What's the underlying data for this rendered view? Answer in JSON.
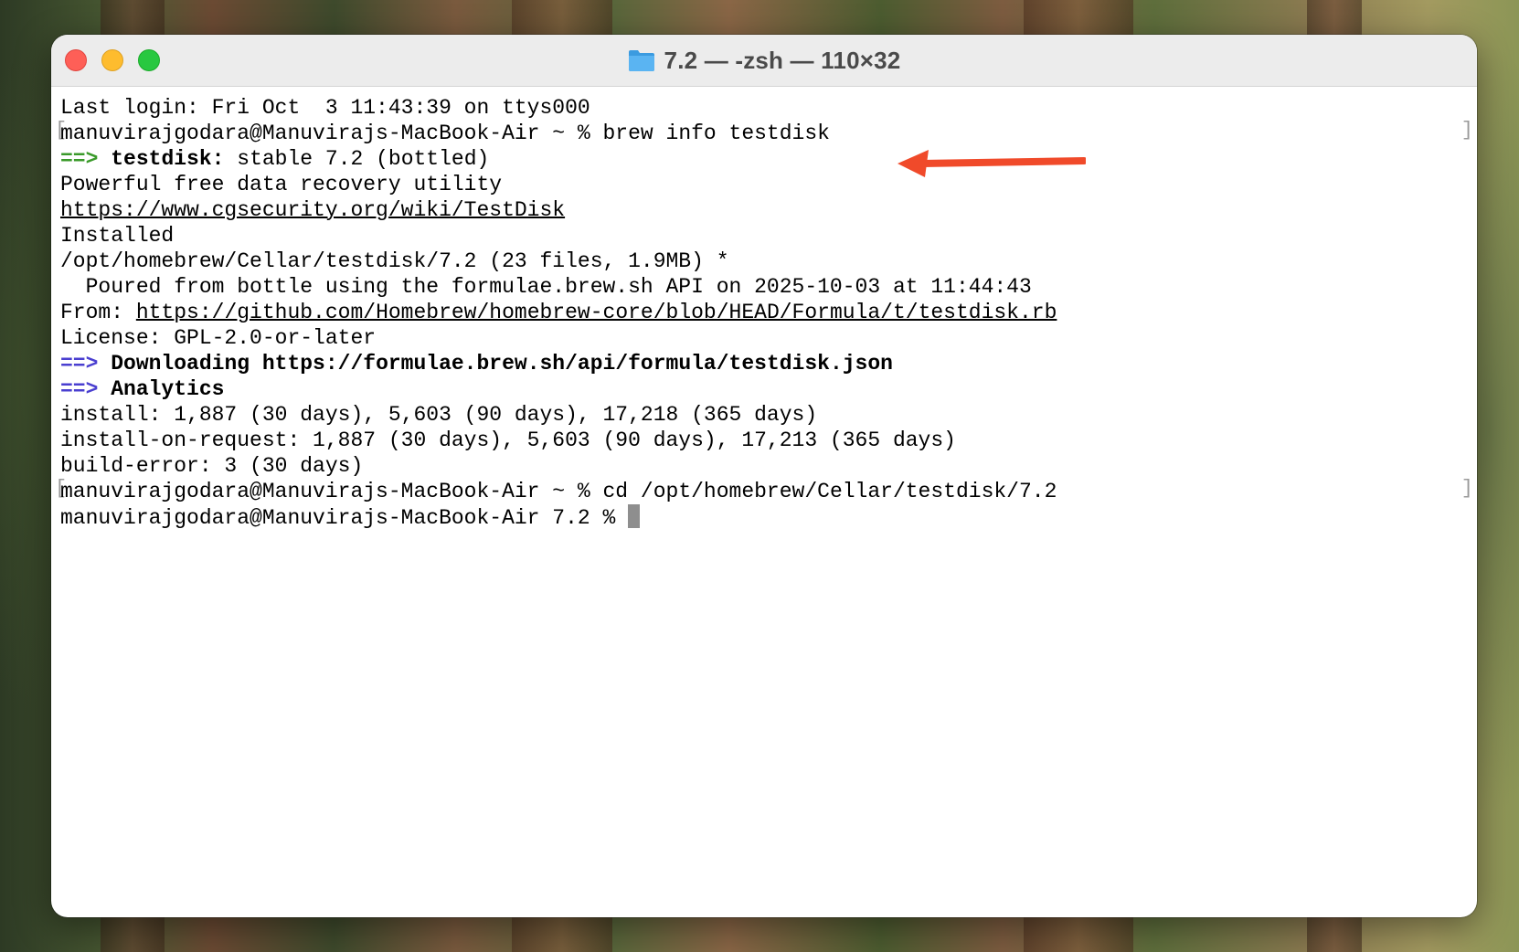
{
  "window": {
    "title": "7.2 — -zsh — 110×32",
    "folder_icon": "folder-icon",
    "traffic_lights": [
      "close",
      "minimize",
      "maximize"
    ]
  },
  "terminal": {
    "last_login": "Last login: Fri Oct  3 11:43:39 on ttys000",
    "prompt1": "manuvirajgodara@Manuvirajs-MacBook-Air ~ % ",
    "cmd1": "brew info testdisk",
    "arrow1": "==>",
    "formula_name": "testdisk:",
    "formula_version": " stable 7.2 (bottled)",
    "description": "Powerful free data recovery utility",
    "homepage": "https://www.cgsecurity.org/wiki/TestDisk",
    "installed_label": "Installed",
    "install_path": "/opt/homebrew/Cellar/testdisk/7.2 (23 files, 1.9MB) *",
    "poured_from": "  Poured from bottle using the formulae.brew.sh API on 2025-10-03 at 11:44:43",
    "from_label": "From: ",
    "from_url": "https://github.com/Homebrew/homebrew-core/blob/HEAD/Formula/t/testdisk.rb",
    "license": "License: GPL-2.0-or-later",
    "arrow2": "==>",
    "downloading": " Downloading https://formulae.brew.sh/api/formula/testdisk.json",
    "arrow3": "==>",
    "analytics": " Analytics",
    "install_stats": "install: 1,887 (30 days), 5,603 (90 days), 17,218 (365 days)",
    "install_on_request_stats": "install-on-request: 1,887 (30 days), 5,603 (90 days), 17,213 (365 days)",
    "build_error_stats": "build-error: 3 (30 days)",
    "prompt2": "manuvirajgodara@Manuvirajs-MacBook-Air ~ % ",
    "cmd2": "cd /opt/homebrew/Cellar/testdisk/7.2",
    "prompt3": "manuvirajgodara@Manuvirajs-MacBook-Air 7.2 % "
  },
  "colors": {
    "prompt_arrow_green": "#3a9a2a",
    "prompt_arrow_purple": "#4a3fd0",
    "annotation_arrow": "#f04a2a"
  }
}
